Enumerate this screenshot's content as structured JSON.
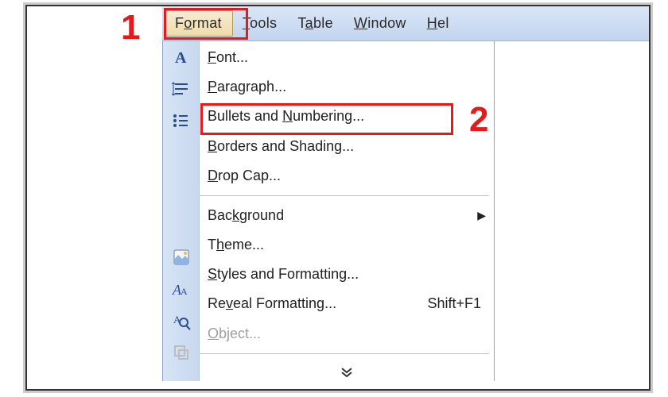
{
  "menu_bar": {
    "items": [
      {
        "pre": "F",
        "u": "o",
        "post": "rmat",
        "active": true
      },
      {
        "pre": "",
        "u": "T",
        "post": "ools",
        "active": false
      },
      {
        "pre": "T",
        "u": "a",
        "post": "ble",
        "active": false
      },
      {
        "pre": "",
        "u": "W",
        "post": "indow",
        "active": false
      },
      {
        "pre": "",
        "u": "H",
        "post": "el",
        "active": false
      }
    ]
  },
  "dropdown": {
    "items": [
      {
        "pre": "",
        "u": "F",
        "post": "ont...",
        "icon": "font-icon"
      },
      {
        "pre": "",
        "u": "P",
        "post": "aragraph...",
        "icon": "paragraph-icon"
      },
      {
        "pre": "Bullets and ",
        "u": "N",
        "post": "umbering...",
        "icon": "bullets-icon"
      },
      {
        "pre": "",
        "u": "B",
        "post": "orders and Shading...",
        "icon": ""
      },
      {
        "pre": "",
        "u": "D",
        "post": "rop Cap...",
        "icon": ""
      },
      {
        "sep": true
      },
      {
        "pre": "Bac",
        "u": "k",
        "post": "ground",
        "icon": "",
        "submenu": true
      },
      {
        "pre": "T",
        "u": "h",
        "post": "eme...",
        "icon": "theme-icon"
      },
      {
        "pre": "",
        "u": "S",
        "post": "tyles and Formatting...",
        "icon": "styles-icon"
      },
      {
        "pre": "Re",
        "u": "v",
        "post": "eal Formatting...",
        "shortcut": "Shift+F1",
        "icon": "reveal-icon"
      },
      {
        "pre": "",
        "u": "O",
        "post": "bject...",
        "icon": "object-icon",
        "disabled": true
      },
      {
        "sep": true
      }
    ]
  },
  "callouts": {
    "one": "1",
    "two": "2"
  }
}
